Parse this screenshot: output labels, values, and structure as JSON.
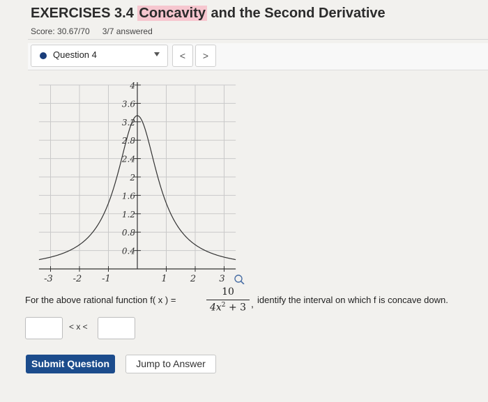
{
  "header": {
    "title_prefix": "EXERCISES 3.4 ",
    "title_highlight": "Concavity",
    "title_suffix": " and the Second Derivative",
    "score": "Score: 30.67/70",
    "answered": "3/7 answered"
  },
  "question_nav": {
    "selected": "Question 4",
    "prev": "<",
    "next": ">"
  },
  "chart_data": {
    "type": "line",
    "function": "10/(4x^2+3)",
    "xlim": [
      -3.4,
      3.4
    ],
    "ylim": [
      0,
      4
    ],
    "x_ticks": [
      "-3",
      "-2",
      "-1",
      "1",
      "2",
      "3"
    ],
    "x_tick_values": [
      -3,
      -2,
      -1,
      1,
      2,
      3
    ],
    "y_ticks": [
      "4",
      "3.6",
      "3.2",
      "2.8",
      "2.4",
      "2",
      "1.6",
      "1.2",
      "0.8",
      "0.4"
    ],
    "y_tick_values": [
      4,
      3.6,
      3.2,
      2.8,
      2.4,
      2,
      1.6,
      1.2,
      0.8,
      0.4
    ],
    "grid": true
  },
  "problem": {
    "prompt_before": "For the above rational function f( x ) =",
    "numerator": "10",
    "denominator_main": "4x",
    "denominator_exp": "2",
    "denominator_tail": " + 3",
    "comma": ",",
    "prompt_after": "identify the interval on which f is concave down.",
    "inequality": "< x <"
  },
  "buttons": {
    "submit": "Submit Question",
    "jump": "Jump to Answer"
  },
  "colors": {
    "submit_bg": "#1c4c8c",
    "highlight": "#f6c6cf",
    "question_dot": "#1a3d7a"
  }
}
